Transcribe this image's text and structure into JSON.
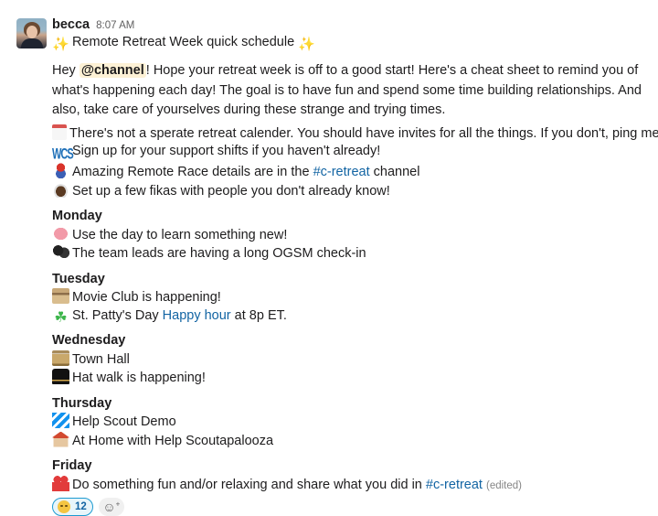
{
  "message": {
    "author": "becca",
    "timestamp": "8:07 AM",
    "title": {
      "emoji_left": "sparkles-icon",
      "text": "Remote Retreat Week quick schedule",
      "emoji_right": "sparkles-icon"
    },
    "intro": {
      "before_mention": "Hey ",
      "mention": "@channel",
      "after_mention": "! Hope your retreat week is off to a good start! Here's a cheat sheet to remind you of what's happening each day! The goal is to have fun and spend some time building relationships. And also, take care of yourselves during these strange and trying times."
    },
    "general_items": [
      {
        "icon": "calendar-icon",
        "text": "There's not a sperate retreat calender. You should have invites for all the things. If you don't, ping me!"
      },
      {
        "icon": "wcs-icon",
        "icon_text": "WCS",
        "text": "Sign up for your support shifts if you haven't already!"
      },
      {
        "icon": "mario-kart-icon",
        "text_before": "Amazing Remote Race details are in the ",
        "link": "#c-retreat",
        "text_after": " channel"
      },
      {
        "icon": "coffee-icon",
        "text": "Set up a few fikas with people you don't already know!"
      }
    ],
    "days": [
      {
        "name": "Monday",
        "items": [
          {
            "icon": "brain-icon",
            "text": "Use the day to learn something new!"
          },
          {
            "icon": "business-suits-icon",
            "text": "The team leads are having a long OGSM check-in"
          }
        ]
      },
      {
        "name": "Tuesday",
        "items": [
          {
            "icon": "popcorn-icon",
            "text": "Movie Club is happening!"
          },
          {
            "icon": "shamrock-icon",
            "text_before": "St. Patty's Day ",
            "link": "Happy hour",
            "text_after": " at 8p ET."
          }
        ]
      },
      {
        "name": "Wednesday",
        "items": [
          {
            "icon": "classical-building-icon",
            "text": "Town Hall"
          },
          {
            "icon": "top-hat-icon",
            "text": "Hat walk is happening!"
          }
        ]
      },
      {
        "name": "Thursday",
        "items": [
          {
            "icon": "helpscout-logo-icon",
            "text": "Help Scout Demo"
          },
          {
            "icon": "house-icon",
            "text": "At Home with Help Scoutapalooza"
          }
        ]
      },
      {
        "name": "Friday",
        "items": [
          {
            "icon": "gift-bow-icon",
            "text_before": "Do something fun and/or relaxing and share what you did in ",
            "link": "#c-retreat",
            "text_after": " ",
            "edited": "(edited)"
          }
        ]
      }
    ],
    "reactions": [
      {
        "icon": "relieved-face-icon",
        "count": "12",
        "selected": true
      }
    ],
    "add_reaction_icon": "add-reaction-icon"
  },
  "colors": {
    "link": "#1264a3",
    "mention_bg": "#fdf1d5",
    "reaction_border": "#1d9bd1",
    "reaction_bg": "#e8f5fa",
    "text": "#1d1c1d",
    "muted": "#616061"
  }
}
